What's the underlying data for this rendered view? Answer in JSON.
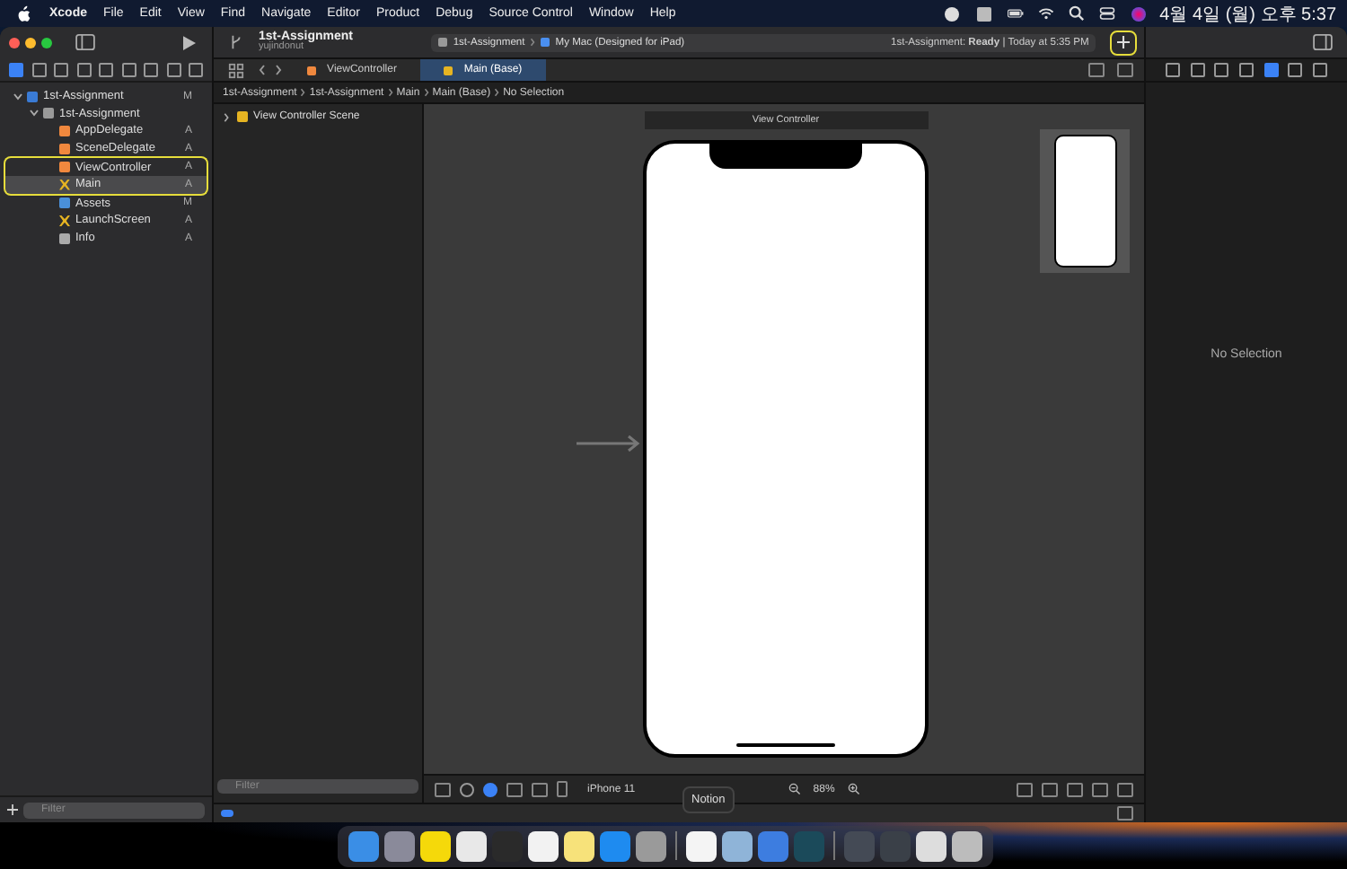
{
  "menu_bar": {
    "app": "Xcode",
    "items": [
      "File",
      "Edit",
      "View",
      "Find",
      "Navigate",
      "Editor",
      "Product",
      "Debug",
      "Source Control",
      "Window",
      "Help"
    ],
    "clock": "4월 4일 (월) 오후 5:37"
  },
  "toolbar": {
    "project": "1st-Assignment",
    "subtitle": "yujindonut",
    "scheme": "1st-Assignment",
    "destination": "My Mac (Designed for iPad)",
    "status": "1st-Assignment: **Ready** | Today at 5:35 PM",
    "add_highlighted": true
  },
  "navigator": {
    "tree": [
      {
        "name": "1st-Assignment",
        "kind": "project",
        "badge": "M",
        "selected": false,
        "highlighted": false,
        "children": [
          {
            "name": "1st-Assignment",
            "kind": "folder",
            "selected": false,
            "highlighted": false,
            "children": [
              {
                "name": "AppDelegate",
                "kind": "swift",
                "badge": "A",
                "selected": false,
                "highlighted": false
              },
              {
                "name": "SceneDelegate",
                "kind": "swift",
                "badge": "A",
                "selected": false,
                "highlighted": false
              },
              {
                "name": "ViewController",
                "kind": "swift",
                "badge": "A",
                "selected": false,
                "highlighted": true
              },
              {
                "name": "Main",
                "kind": "storyboard",
                "badge": "A",
                "selected": true,
                "highlighted": true
              },
              {
                "name": "Assets",
                "kind": "assets",
                "badge": "M",
                "selected": false,
                "highlighted": false
              },
              {
                "name": "LaunchScreen",
                "kind": "storyboard",
                "badge": "A",
                "selected": false,
                "highlighted": false
              },
              {
                "name": "Info",
                "kind": "plist",
                "badge": "A",
                "selected": false,
                "highlighted": false
              }
            ]
          }
        ]
      }
    ],
    "filter_placeholder": "Filter"
  },
  "tabs": [
    {
      "label": "ViewController",
      "kind": "swift",
      "selected": false
    },
    {
      "label": "Main (Base)",
      "kind": "storyboard",
      "selected": true
    }
  ],
  "breadcrumb": [
    "1st-Assignment",
    "1st-Assignment",
    "Main",
    "Main (Base)",
    "No Selection"
  ],
  "outline": {
    "scene": "View Controller Scene",
    "filter_placeholder": "Filter"
  },
  "canvas": {
    "scene_title": "View Controller",
    "device": "iPhone 11",
    "zoom": "88%"
  },
  "inspector": {
    "empty": "No Selection"
  },
  "dock": {
    "tooltip": "Notion",
    "apps": [
      {
        "color": "#3a8ee6"
      },
      {
        "color": "#8a8a9a"
      },
      {
        "color": "#f5d90a"
      },
      {
        "color": "#e8e8e8"
      },
      {
        "color": "#2a2a2a"
      },
      {
        "color": "#f2f2f2"
      },
      {
        "color": "#f7e27a"
      },
      {
        "color": "#1e8bf0"
      },
      {
        "color": "#9a9a9a"
      },
      {
        "color": "#f4f4f4"
      },
      {
        "color": "#8fb4d8"
      },
      {
        "color": "#3d7de0"
      },
      {
        "color": "#1b4a5a"
      },
      {
        "color": "#444a55"
      },
      {
        "color": "#3a4048"
      },
      {
        "color": "#dddddd"
      },
      {
        "color": "#bcbcbc"
      }
    ]
  }
}
